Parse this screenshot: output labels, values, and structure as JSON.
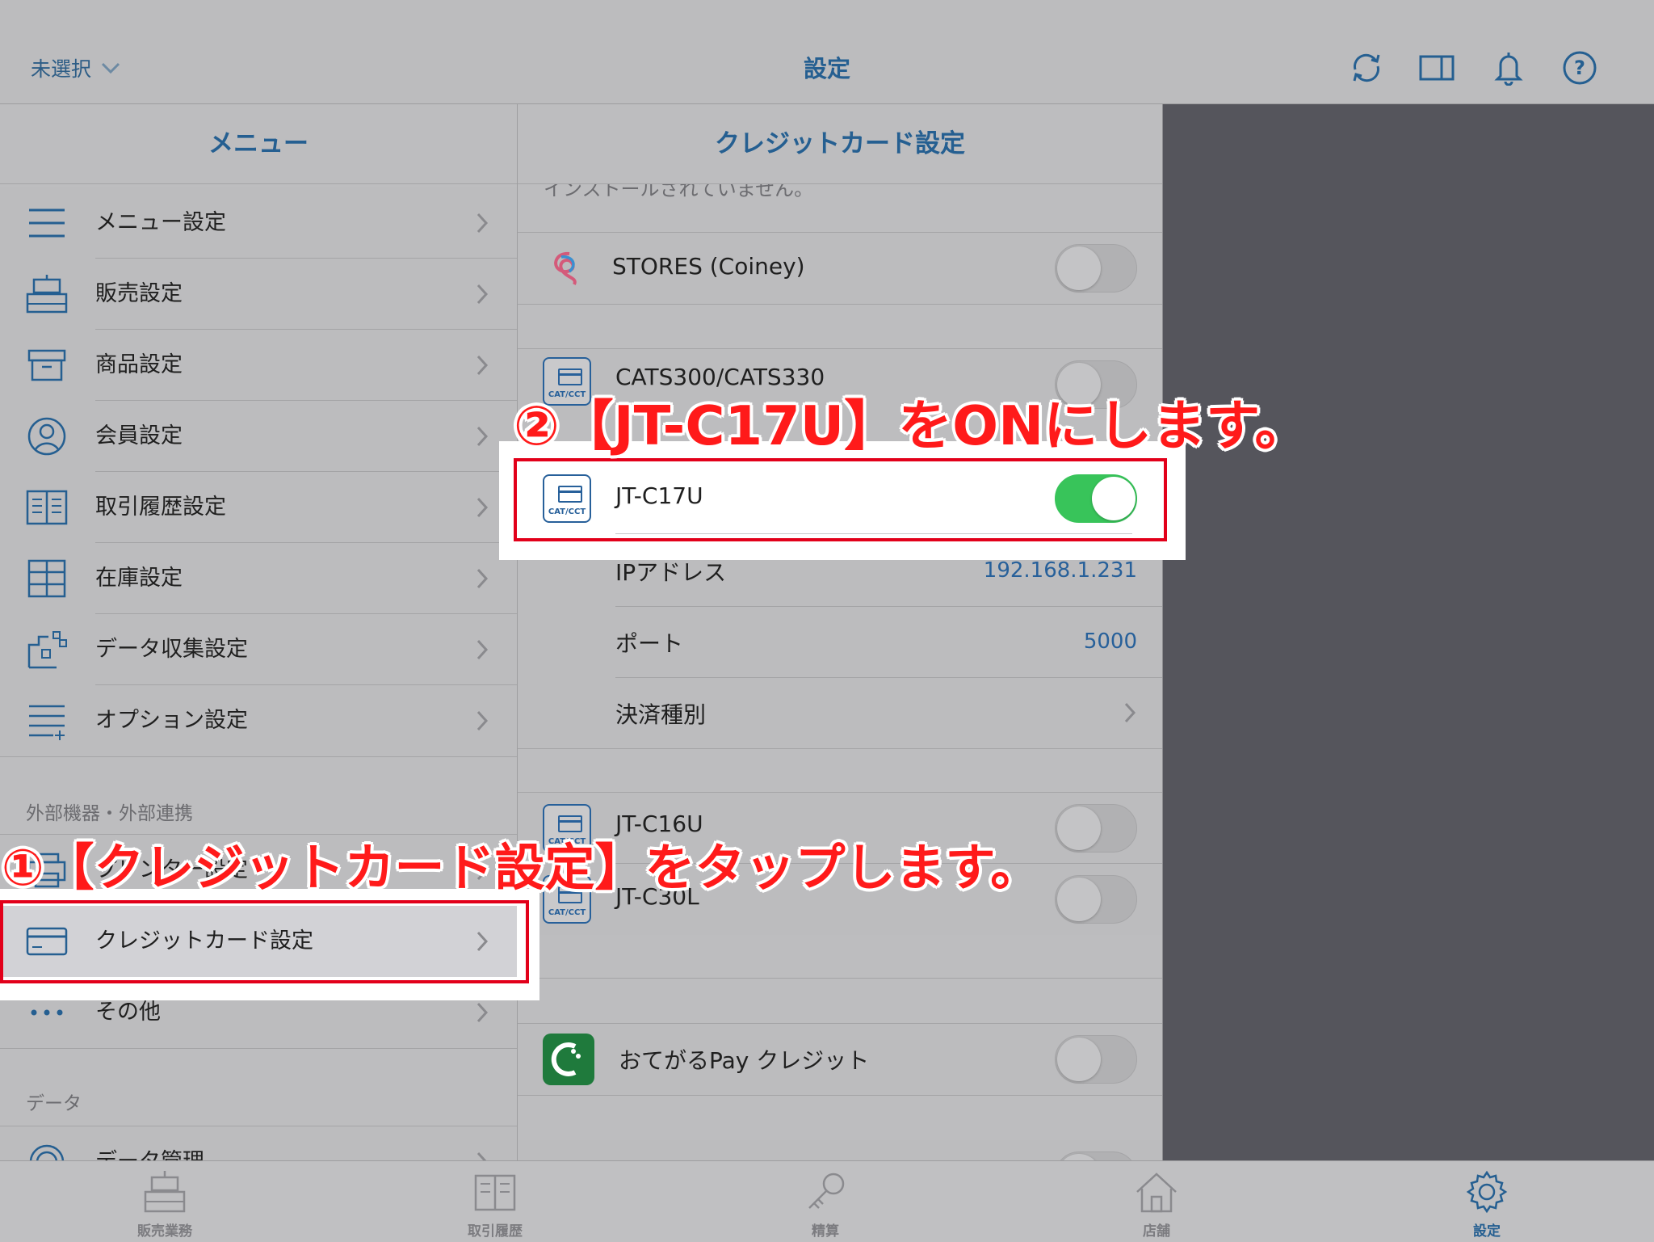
{
  "header": {
    "store_selector": "未選択",
    "title": "設定",
    "icons": [
      "refresh-icon",
      "split-view-icon",
      "bell-icon",
      "help-icon"
    ]
  },
  "menu": {
    "title": "メニュー",
    "items": [
      {
        "label": "メニュー設定",
        "icon": "menu-list-icon"
      },
      {
        "label": "販売設定",
        "icon": "register-icon"
      },
      {
        "label": "商品設定",
        "icon": "box-icon"
      },
      {
        "label": "会員設定",
        "icon": "user-icon"
      },
      {
        "label": "取引履歴設定",
        "icon": "book-icon"
      },
      {
        "label": "在庫設定",
        "icon": "shelves-icon"
      },
      {
        "label": "データ収集設定",
        "icon": "data-collect-icon"
      },
      {
        "label": "オプション設定",
        "icon": "list-plus-icon"
      }
    ],
    "section_external": "外部機器・外部連携",
    "external_items": [
      {
        "label": "プリンター設定",
        "icon": "printer-icon"
      },
      {
        "label": "クレジットカード設定",
        "icon": "credit-card-icon"
      },
      {
        "label": "その他",
        "icon": "more-icon"
      }
    ],
    "section_data": "データ",
    "data_items": [
      {
        "label": "データ管理",
        "icon": "data-icon"
      }
    ]
  },
  "detail": {
    "title": "クレジットカード設定",
    "cut_text": "インストールされていません。",
    "stores": {
      "label": "STORES (Coiney)",
      "on": false
    },
    "cats": {
      "label": "CATS300/CATS330",
      "icon_text": "CAT/CCT",
      "on": false
    },
    "jtc17u": {
      "label": "JT-C17U",
      "icon_text": "CAT/CCT",
      "on": true
    },
    "ip": {
      "label": "IPアドレス",
      "value": "192.168.1.231"
    },
    "port": {
      "label": "ポート",
      "value": "5000"
    },
    "payment_type": {
      "label": "決済種別"
    },
    "jtc16u": {
      "label": "JT-C16U",
      "icon_text": "CAT/CCT",
      "on": false
    },
    "jtc30l": {
      "label": "JT-C30L",
      "icon_text": "CAT/CCT",
      "on": false
    },
    "otegaru": {
      "label": "おてがるPay クレジット",
      "on": false
    }
  },
  "annotations": {
    "step1": "①【クレジットカード設定】をタップします。",
    "step2": "②【JT-C17U】をONにします。"
  },
  "tabbar": {
    "tabs": [
      {
        "label": "販売業務",
        "icon": "register-icon"
      },
      {
        "label": "取引履歴",
        "icon": "book-icon"
      },
      {
        "label": "精算",
        "icon": "key-icon"
      },
      {
        "label": "店舗",
        "icon": "house-icon"
      },
      {
        "label": "設定",
        "icon": "gear-icon",
        "active": true
      }
    ]
  },
  "colors": {
    "accent": "#255f91",
    "toggle_on": "#38c45a",
    "annotation": "#ff1a1a",
    "highlight": "#e2001a"
  }
}
